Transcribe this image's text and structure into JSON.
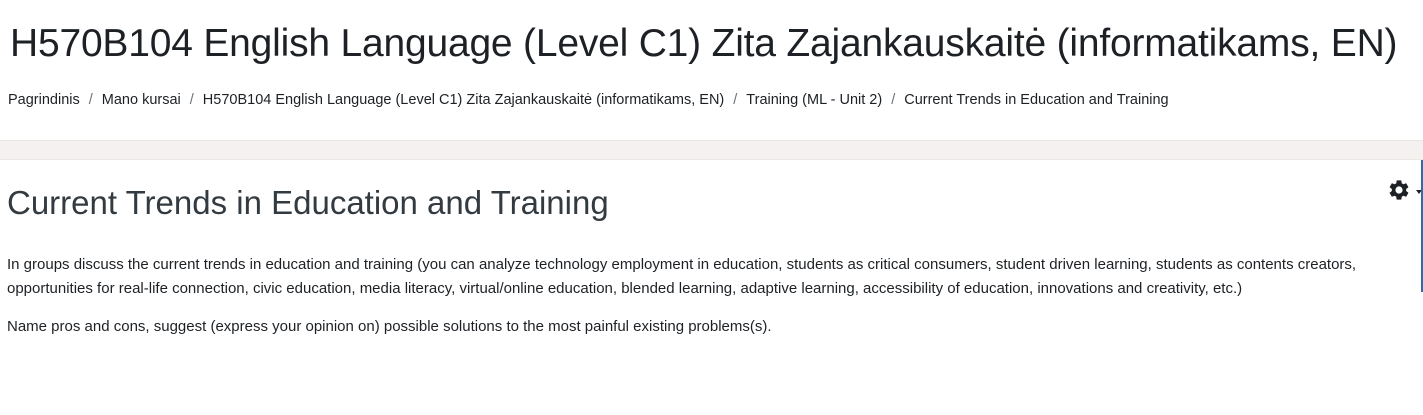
{
  "header": {
    "course_title": "H570B104 English Language (Level C1) Zita Zajankauskaitė (informatikams, EN)",
    "breadcrumb": [
      "Pagrindinis",
      "Mano kursai",
      "H570B104 English Language (Level C1) Zita Zajankauskaitė (informatikams, EN)",
      "Training (ML - Unit 2)",
      "Current Trends in Education and Training"
    ],
    "separator": "/"
  },
  "main": {
    "activity_title": "Current Trends in Education and Training",
    "settings_icon": "gear-icon",
    "paragraphs": [
      "In groups discuss the current trends in education and training (you can analyze technology employment in education, students as critical consumers, student driven learning, students as contents creators, opportunities for real-life connection, civic education, media literacy, virtual/online education, blended learning, adaptive learning, accessibility of education, innovations and creativity, etc.)",
      "Name pros and cons, suggest (express your opinion on) possible solutions to the most painful existing problems(s)."
    ]
  },
  "colors": {
    "text": "#1d2125",
    "band": "#f4f1f0",
    "accent": "#2b6cb0"
  }
}
